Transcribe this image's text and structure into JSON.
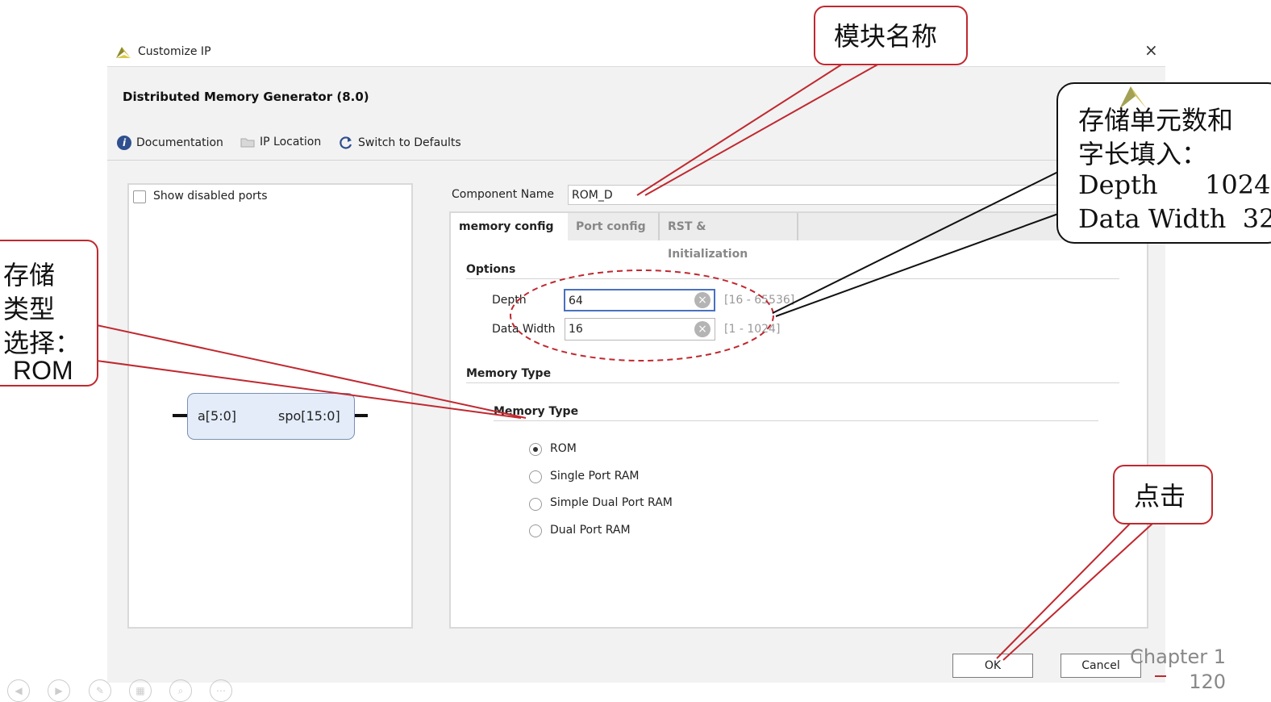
{
  "window": {
    "title": "Customize IP",
    "close_glyph": "×"
  },
  "ip": {
    "name": "Distributed Memory Generator (8.0)"
  },
  "toolbar": {
    "documentation": "Documentation",
    "ip_location": "IP Location",
    "switch_defaults": "Switch to Defaults"
  },
  "left_panel": {
    "show_disabled_ports": "Show disabled ports",
    "pin_in": "a[5:0]",
    "pin_out": "spo[15:0]"
  },
  "component": {
    "label": "Component Name",
    "value": "ROM_D"
  },
  "tabs": [
    {
      "label": "memory config",
      "active": true
    },
    {
      "label": "Port config",
      "active": false
    },
    {
      "label": "RST & Initialization",
      "active": false
    }
  ],
  "options": {
    "title": "Options",
    "depth_label": "Depth",
    "depth_value": "64",
    "depth_range": "[16 - 65536]",
    "width_label": "Data Width",
    "width_value": "16",
    "width_range": "[1 - 1024]"
  },
  "memory_type": {
    "section_title": "Memory Type",
    "group_title": "Memory Type",
    "options": [
      "ROM",
      "Single Port RAM",
      "Simple Dual Port RAM",
      "Dual Port RAM"
    ],
    "selected": "ROM"
  },
  "buttons": {
    "ok": "OK",
    "cancel": "Cancel"
  },
  "annotations": {
    "module_name": "模块名称",
    "depth_width": [
      "存储单元数和",
      "字长填入：",
      "Depth",
      "1024",
      "Data Width  32"
    ],
    "mem_type": [
      "存储",
      "类型",
      "选择：",
      "ROM"
    ],
    "click": "点击"
  },
  "slide": {
    "chapter": "Chapter 1",
    "page": "120"
  },
  "colors": {
    "annotation_red": "#c0282f",
    "focus_blue": "#4a70c0",
    "symbol_fill": "#e3ecf8"
  }
}
